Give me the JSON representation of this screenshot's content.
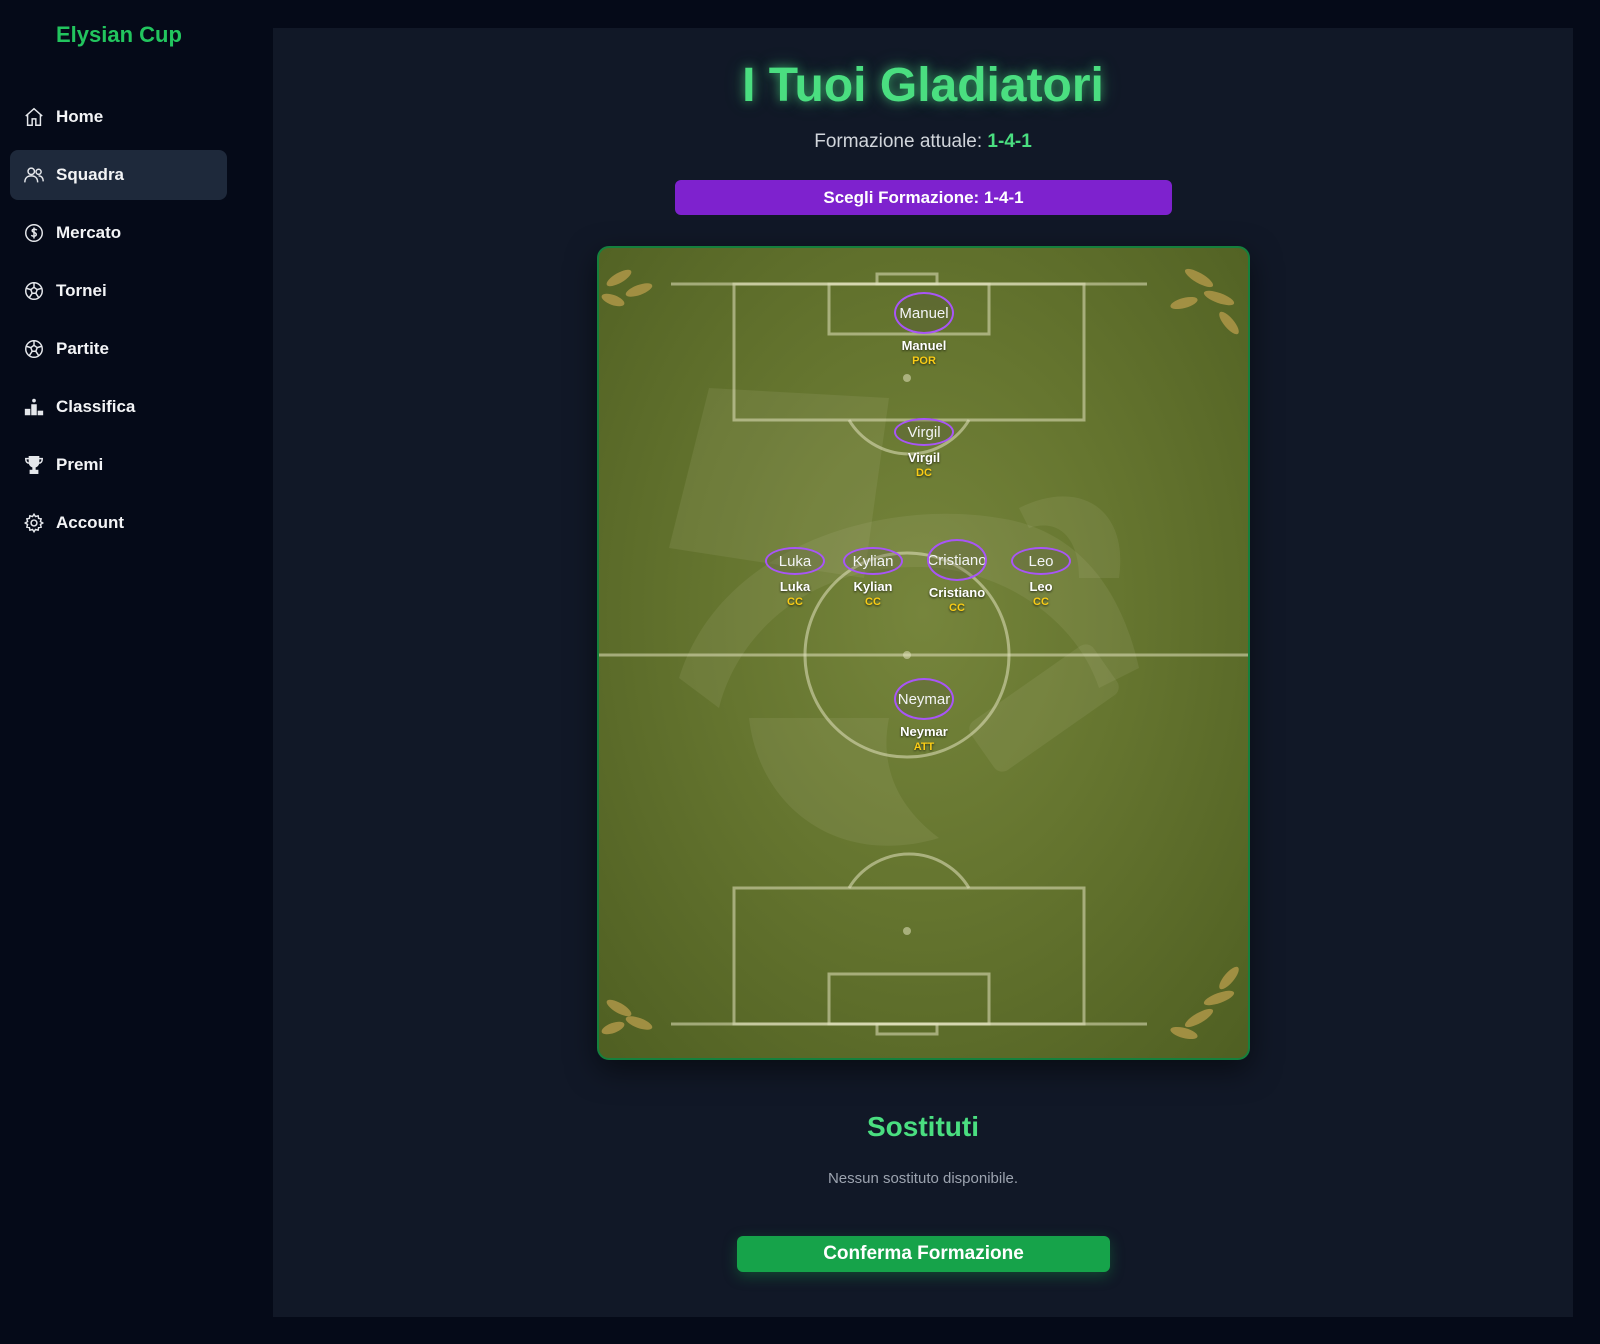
{
  "app": {
    "brand": "Elysian Cup"
  },
  "sidebar": {
    "items": [
      {
        "label": "Home",
        "icon": "home-icon",
        "active": false
      },
      {
        "label": "Squadra",
        "icon": "users-icon",
        "active": true
      },
      {
        "label": "Mercato",
        "icon": "coin-icon",
        "active": false
      },
      {
        "label": "Tornei",
        "icon": "soccer-ball-icon",
        "active": false
      },
      {
        "label": "Partite",
        "icon": "soccer-ball-icon",
        "active": false
      },
      {
        "label": "Classifica",
        "icon": "podium-icon",
        "active": false
      },
      {
        "label": "Premi",
        "icon": "trophy-icon",
        "active": false
      },
      {
        "label": "Account",
        "icon": "gear-icon",
        "active": false
      }
    ]
  },
  "main": {
    "title": "I Tuoi Gladiatori",
    "formation_prefix": "Formazione attuale:",
    "formation_value": "1-4-1",
    "choose_button": "Scegli Formazione: 1-4-1",
    "players": [
      {
        "name": "Manuel",
        "role": "POR",
        "img_alt": "Manuel"
      },
      {
        "name": "Virgil",
        "role": "DC",
        "img_alt": "Virgil"
      },
      {
        "name": "Luka",
        "role": "CC",
        "img_alt": "Luka"
      },
      {
        "name": "Kylian",
        "role": "CC",
        "img_alt": "Kylian"
      },
      {
        "name": "Cristiano",
        "role": "CC",
        "img_alt": "Cristiano"
      },
      {
        "name": "Leo",
        "role": "CC",
        "img_alt": "Leo"
      },
      {
        "name": "Neymar",
        "role": "ATT",
        "img_alt": "Neymar"
      }
    ],
    "subs_title": "Sostituti",
    "subs_empty": "Nessun sostituto disponibile.",
    "confirm_button": "Conferma Formazione"
  },
  "colors": {
    "accent_green": "#4ade80",
    "button_purple": "#7e22ce",
    "button_green": "#16a34a",
    "role_yellow": "#facc15",
    "avatar_border": "#a855f7"
  }
}
